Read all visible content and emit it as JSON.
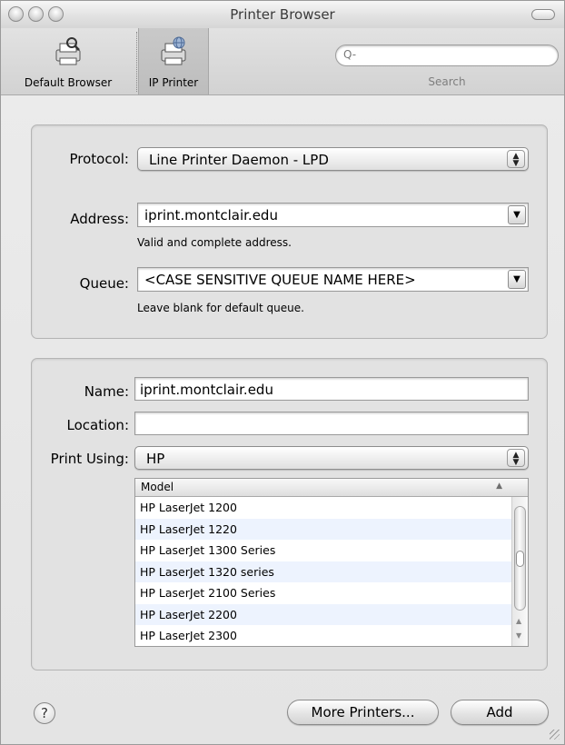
{
  "window": {
    "title": "Printer Browser"
  },
  "toolbar": {
    "items": [
      {
        "label": "Default Browser",
        "icon": "default-browser-printer-icon"
      },
      {
        "label": "IP Printer",
        "icon": "ip-printer-icon",
        "selected": true
      }
    ],
    "search": {
      "placeholder": "",
      "glyph": "Q-",
      "caption": "Search"
    }
  },
  "ip_group": {
    "protocol": {
      "label": "Protocol:",
      "value": "Line Printer Daemon - LPD"
    },
    "address": {
      "label": "Address:",
      "value": "iprint.montclair.edu",
      "hint": "Valid and complete address."
    },
    "queue": {
      "label": "Queue:",
      "value": "<CASE SENSITIVE QUEUE NAME HERE>",
      "hint": "Leave blank for default queue."
    }
  },
  "details_group": {
    "name": {
      "label": "Name:",
      "value": "iprint.montclair.edu"
    },
    "location": {
      "label": "Location:",
      "value": ""
    },
    "print_using": {
      "label": "Print Using:",
      "value": "HP"
    },
    "model_table": {
      "header": "Model",
      "rows": [
        "HP LaserJet 1200",
        "HP LaserJet 1220",
        "HP LaserJet 1300 Series",
        "HP LaserJet 1320 series",
        "HP LaserJet 2100 Series",
        "HP LaserJet 2200",
        "HP LaserJet 2300"
      ]
    }
  },
  "buttons": {
    "help": "?",
    "more_printers": "More Printers...",
    "add": "Add"
  },
  "colors": {
    "alt_row": "#edf3fe",
    "window_bg": "#e6e6e6"
  }
}
